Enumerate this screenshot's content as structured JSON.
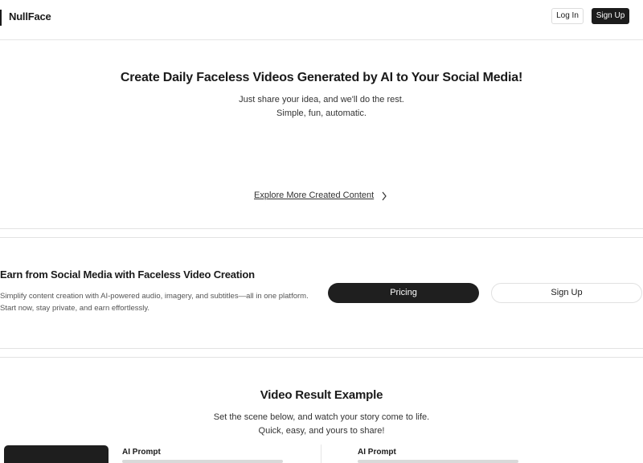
{
  "header": {
    "logo": "NullFace",
    "login_label": "Log In",
    "signup_label": "Sign Up"
  },
  "hero": {
    "title": "Create Daily Faceless Videos Generated by AI to Your Social Media!",
    "subtitle_line1": "Just share your idea, and we'll do the rest.",
    "subtitle_line2": "Simple, fun, automatic.",
    "explore_link": "Explore More Created Content",
    "explore_icon": "chevron-right-icon"
  },
  "earn": {
    "title": "Earn from Social Media with Faceless Video Creation",
    "description": "Simplify content creation with AI-powered audio, imagery, and subtitles—all in one platform. Start now, stay private, and earn effortlessly.",
    "pricing_label": "Pricing",
    "signup_label": "Sign Up"
  },
  "video_example": {
    "title": "Video Result Example",
    "subtitle_line1": "Set the scene below, and watch your story come to life.",
    "subtitle_line2": "Quick, easy, and yours to share!",
    "prompt_label_1": "AI Prompt",
    "prompt_label_2": "AI Prompt"
  },
  "colors": {
    "primary_dark": "#1f1f1f",
    "border": "#e1e1e1",
    "text": "#1a1a1a"
  }
}
